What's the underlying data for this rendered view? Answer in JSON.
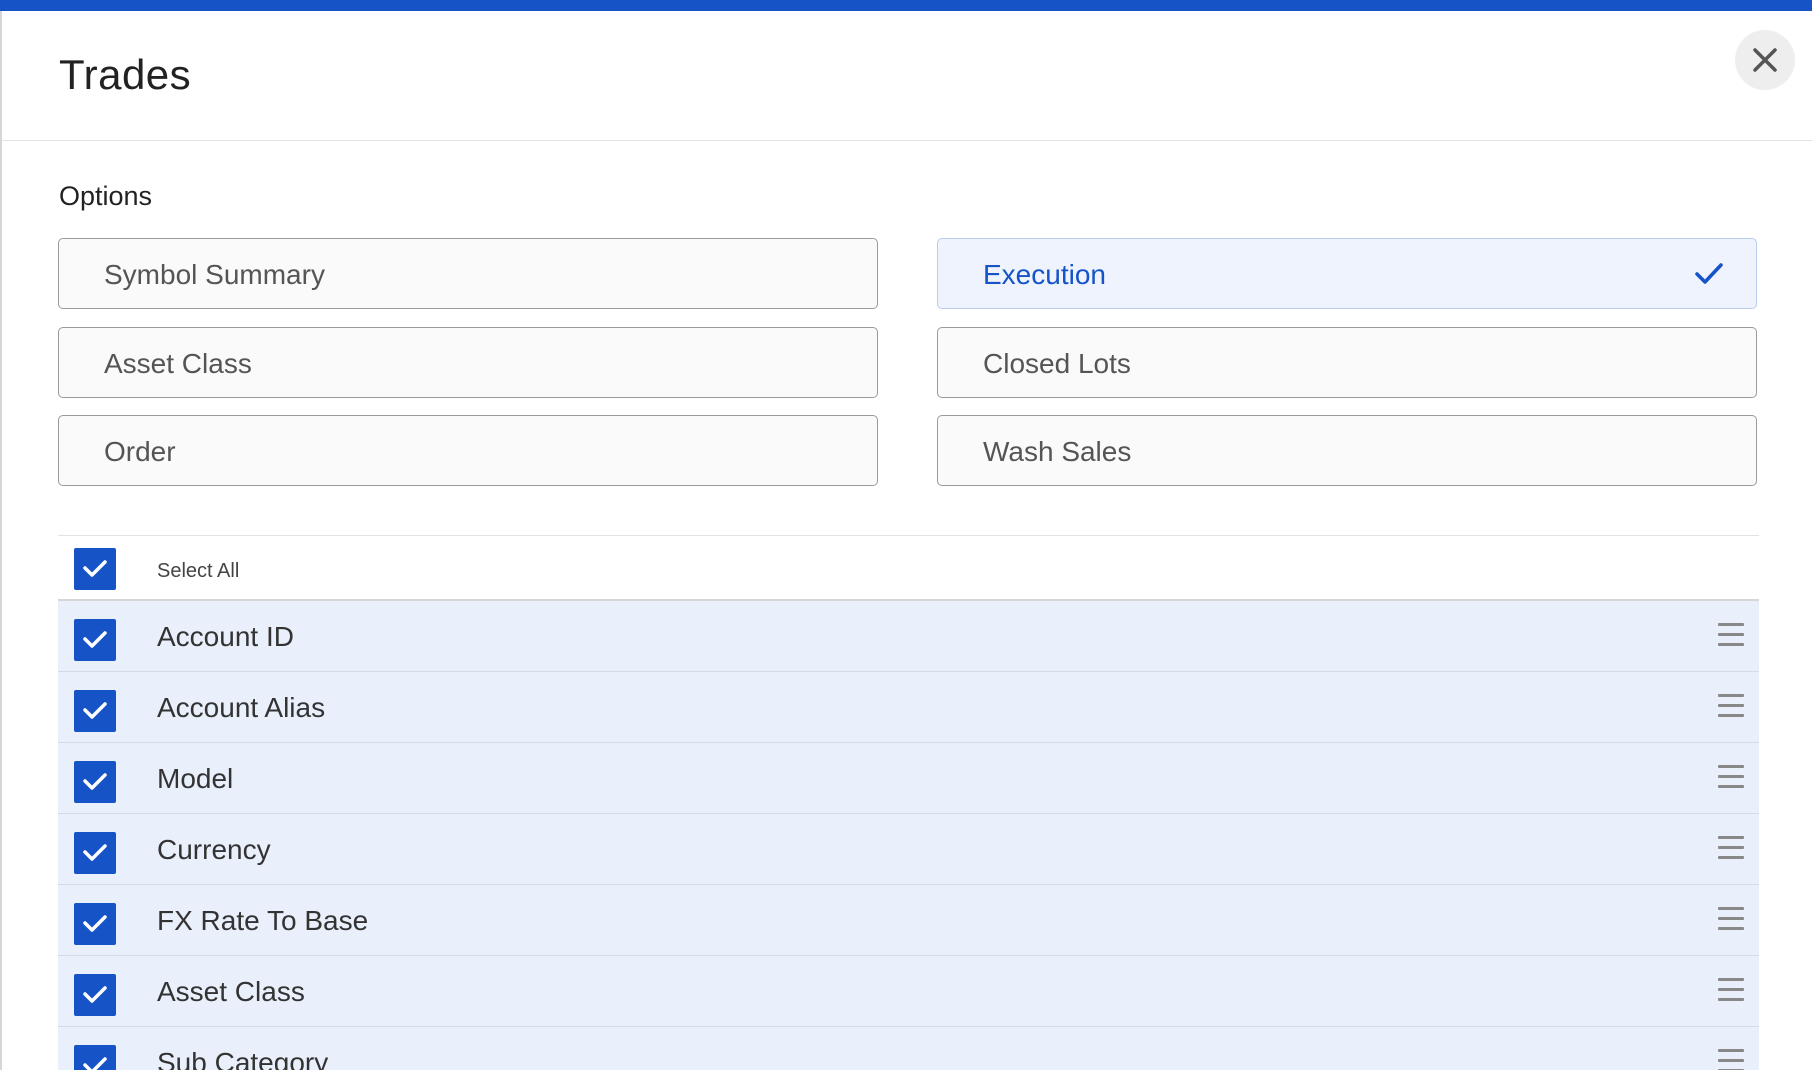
{
  "dialog": {
    "title": "Trades",
    "close_icon": "close-icon",
    "accent_color": "#1553c7"
  },
  "options": {
    "label": "Options",
    "items": [
      {
        "label": "Symbol Summary",
        "selected": false
      },
      {
        "label": "Execution",
        "selected": true
      },
      {
        "label": "Asset Class",
        "selected": false
      },
      {
        "label": "Closed Lots",
        "selected": false
      },
      {
        "label": "Order",
        "selected": false
      },
      {
        "label": "Wash Sales",
        "selected": false
      }
    ]
  },
  "fields": {
    "select_all": {
      "label": "Select All",
      "checked": true
    },
    "items": [
      {
        "label": "Account ID",
        "checked": true
      },
      {
        "label": "Account Alias",
        "checked": true
      },
      {
        "label": "Model",
        "checked": true
      },
      {
        "label": "Currency",
        "checked": true
      },
      {
        "label": "FX Rate To Base",
        "checked": true
      },
      {
        "label": "Asset Class",
        "checked": true
      },
      {
        "label": "Sub Category",
        "checked": true
      }
    ]
  }
}
